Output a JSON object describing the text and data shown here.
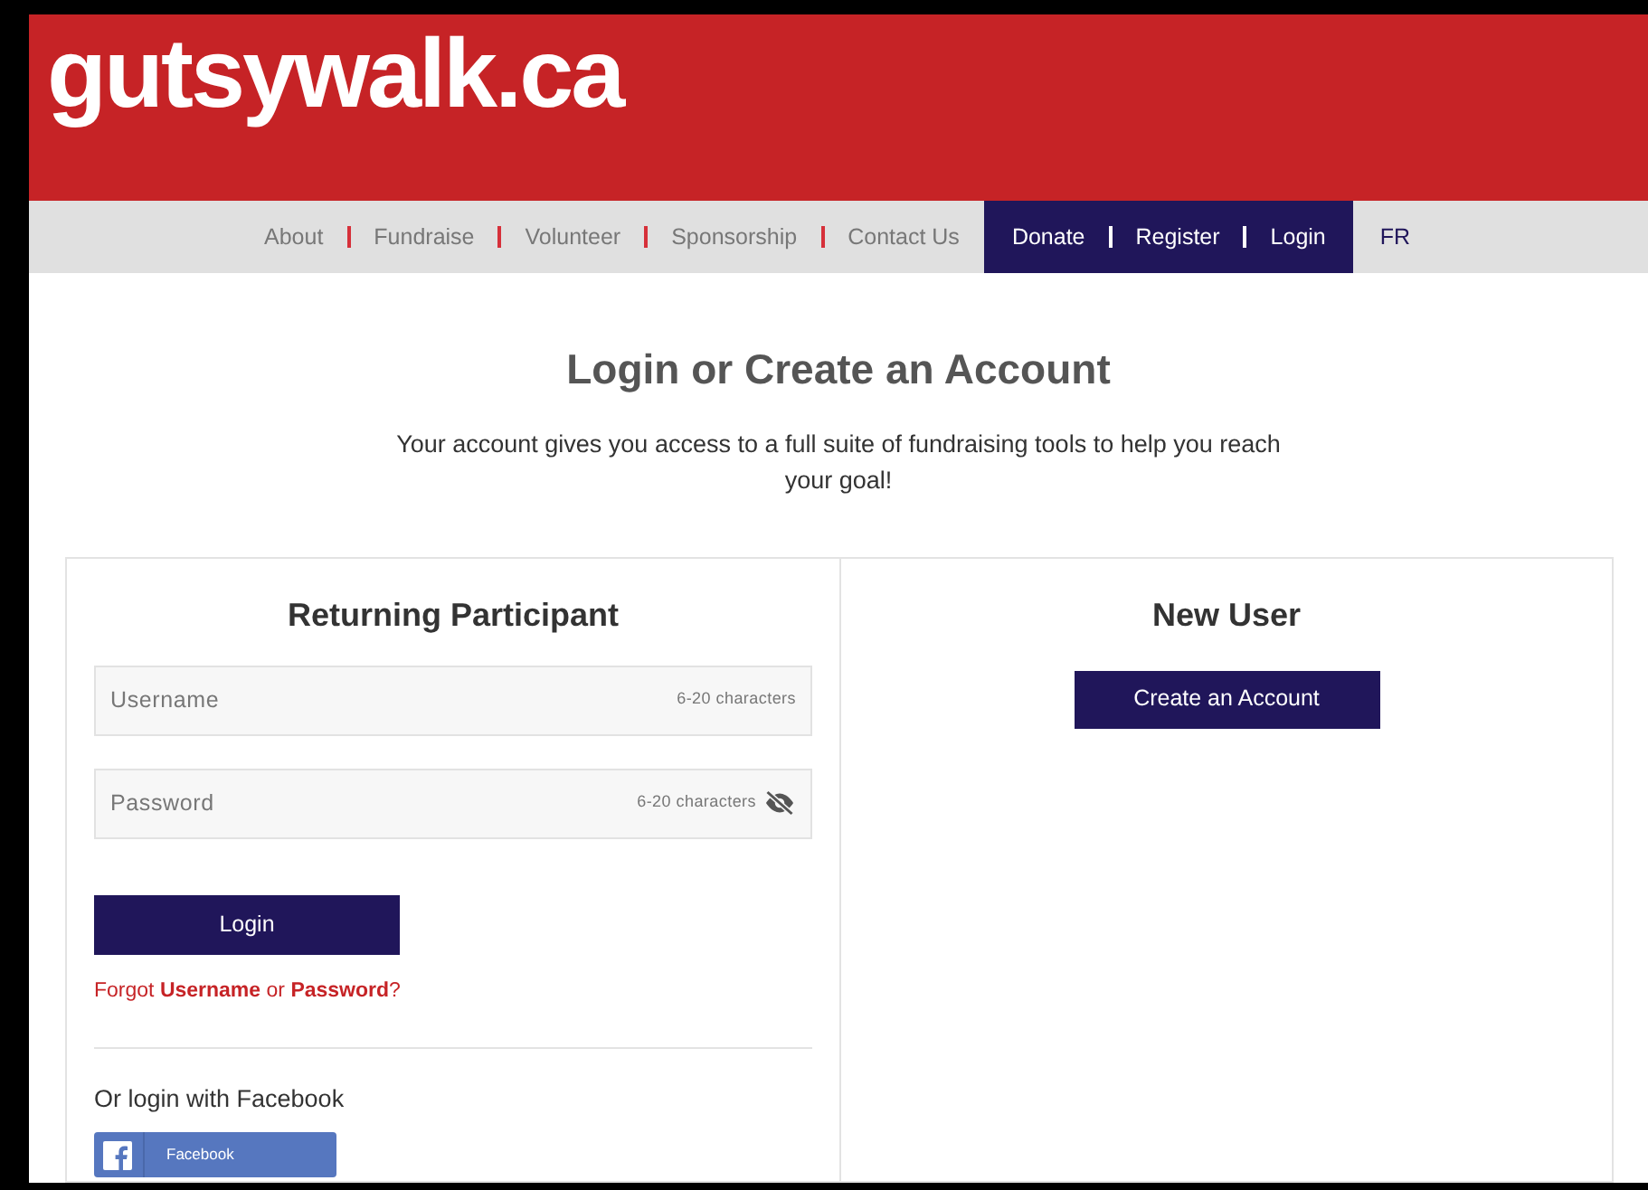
{
  "logo": "gutsywalk.ca",
  "nav": {
    "links": [
      "About",
      "Fundraise",
      "Volunteer",
      "Sponsorship",
      "Contact Us"
    ],
    "account_links": [
      "Donate",
      "Register",
      "Login"
    ],
    "language": "FR"
  },
  "heading": "Login or Create an Account",
  "intro": "Your account gives you access to a full suite of fundraising tools to help you reach your goal!",
  "returning": {
    "title": "Returning Participant",
    "fields": [
      {
        "kind": "text",
        "placeholder": "Username",
        "hint": "6-20 characters"
      },
      {
        "kind": "password",
        "placeholder": "Password",
        "hint": "6-20 characters"
      }
    ],
    "login_button": "Login",
    "forgot": "Forgot **Username** or **Password**?",
    "social_label": "Or login with Facebook",
    "facebook_button": "Facebook"
  },
  "new_user": {
    "title": "New User",
    "create_button": "Create an Account"
  }
}
